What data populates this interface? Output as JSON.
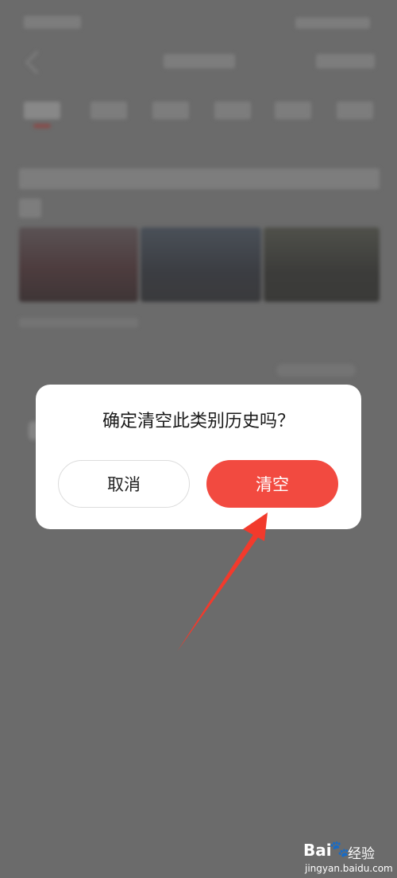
{
  "dialog": {
    "message": "确定清空此类别历史吗？",
    "cancel_label": "取消",
    "confirm_label": "清空"
  },
  "watermark": {
    "logo": "Bai",
    "paw_icon": "paw-icon",
    "brand_cn": "经验",
    "url": "jingyan.baidu.com"
  },
  "colors": {
    "overlay": "#6b6b6b",
    "accent": "#f24a40",
    "annotation_arrow": "#f23a2c"
  }
}
